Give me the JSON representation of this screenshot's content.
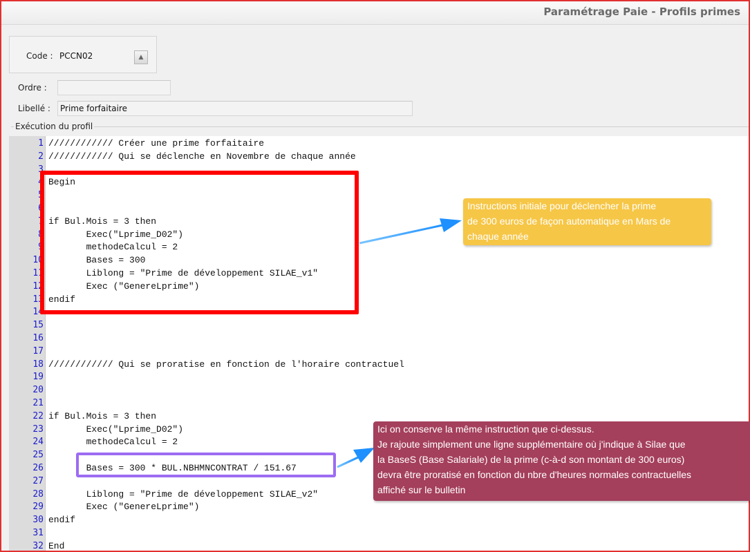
{
  "window": {
    "title": "Paramétrage Paie - Profils primes"
  },
  "form": {
    "code_label": "Code :",
    "code_value": "PCCN02",
    "ordre_label": "Ordre :",
    "ordre_value": "",
    "libelle_label": "Libellé :",
    "libelle_value": "Prime forfaitaire",
    "group_label": "Exécution du profil"
  },
  "editor": {
    "lines": [
      {
        "n": "1",
        "text": "//////////// Créer une prime forfaitaire"
      },
      {
        "n": "2",
        "text": "//////////// Qui se déclenche en Novembre de chaque année"
      },
      {
        "n": "3",
        "text": ""
      },
      {
        "n": "4",
        "text": "Begin"
      },
      {
        "n": "5",
        "text": ""
      },
      {
        "n": "6",
        "text": ""
      },
      {
        "n": "7",
        "text": "if Bul.Mois = 3 then"
      },
      {
        "n": "8",
        "text": "       Exec(\"Lprime_D02\")"
      },
      {
        "n": "9",
        "text": "       methodeCalcul = 2"
      },
      {
        "n": "10",
        "text": "       Bases = 300"
      },
      {
        "n": "11",
        "text": "       Liblong = \"Prime de développement SILAE_v1\""
      },
      {
        "n": "12",
        "text": "       Exec (\"GenereLprime\")"
      },
      {
        "n": "13",
        "text": "endif"
      },
      {
        "n": "14",
        "text": ""
      },
      {
        "n": "15",
        "text": ""
      },
      {
        "n": "16",
        "text": ""
      },
      {
        "n": "17",
        "text": ""
      },
      {
        "n": "18",
        "text": "//////////// Qui se proratise en fonction de l'horaire contractuel"
      },
      {
        "n": "19",
        "text": ""
      },
      {
        "n": "20",
        "text": ""
      },
      {
        "n": "21",
        "text": ""
      },
      {
        "n": "22",
        "text": "if Bul.Mois = 3 then"
      },
      {
        "n": "23",
        "text": "       Exec(\"Lprime_D02\")"
      },
      {
        "n": "24",
        "text": "       methodeCalcul = 2"
      },
      {
        "n": "25",
        "text": ""
      },
      {
        "n": "26",
        "text": "       Bases = 300 * BUL.NBHMNCONTRAT / 151.67"
      },
      {
        "n": "27",
        "text": ""
      },
      {
        "n": "28",
        "text": "       Liblong = \"Prime de développement SILAE_v2\""
      },
      {
        "n": "29",
        "text": "       Exec (\"GenereLprime\")"
      },
      {
        "n": "30",
        "text": "endif"
      },
      {
        "n": "31",
        "text": ""
      },
      {
        "n": "32",
        "text": "End"
      }
    ]
  },
  "annotations": {
    "yellow": {
      "color": "#f6c646",
      "lines": [
        "Instructions initiale pour déclencher la prime",
        "de 300 euros de façon automatique en Mars de",
        "chaque année"
      ]
    },
    "purple": {
      "color": "#a43f5c",
      "lines": [
        "Ici on conserve la même instruction que ci-dessus.",
        "Je rajoute simplement une ligne supplémentaire où j'indique à Silae que",
        "la BaseS (Base Salariale) de la prime (c-à-d son montant de 300 euros)",
        "devra être proratisé en fonction du nbre d'heures normales contractuelles",
        "affiché sur le bulletin"
      ]
    },
    "red_box_color": "#ff0000",
    "violet_box_color": "#9d6cf3",
    "arrow_color": "#1e90ff"
  }
}
